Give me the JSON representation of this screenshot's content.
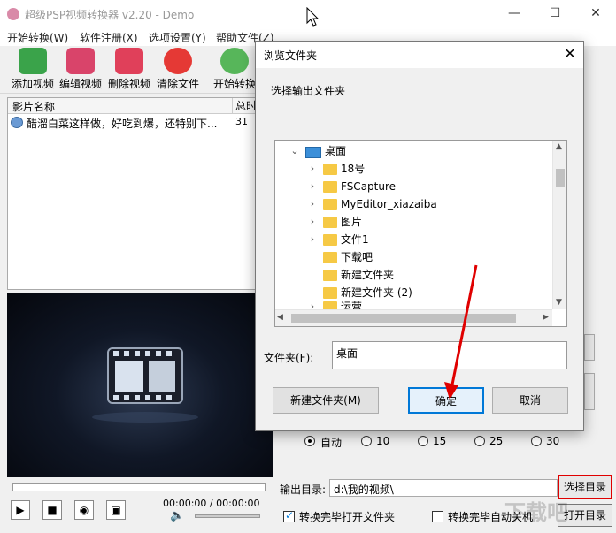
{
  "window": {
    "title": "超级PSP视频转换器 v2.20 - Demo"
  },
  "menu": [
    "开始转换(W)",
    "软件注册(X)",
    "选项设置(Y)",
    "帮助文件(Z)"
  ],
  "toolbar": [
    "添加视频",
    "编辑视频",
    "删除视频",
    "清除文件",
    "开始转换"
  ],
  "list": {
    "columns": [
      "影片名称",
      "总时"
    ],
    "rows": [
      {
        "name": "醋溜白菜这样做，好吃到爆，还特别下...",
        "duration": "31"
      }
    ]
  },
  "player": {
    "time": "00:00:00 / 00:00:00"
  },
  "framerate": {
    "options": [
      "自动",
      "10",
      "15",
      "25",
      "30"
    ],
    "selected": "自动"
  },
  "output": {
    "label": "输出目录:",
    "path": "d:\\我的视频\\",
    "choose_button": "选择目录",
    "open_button": "打开目录",
    "open_after": "转换完毕打开文件夹",
    "shutdown_after": "转换完毕自动关机"
  },
  "dialog": {
    "title": "浏览文件夹",
    "description": "选择输出文件夹",
    "tree": [
      {
        "label": "桌面",
        "expanded": true,
        "root": true
      },
      {
        "label": "18号",
        "expandable": true
      },
      {
        "label": "FSCapture",
        "expandable": true
      },
      {
        "label": "MyEditor_xiazaiba",
        "expandable": true
      },
      {
        "label": "图片",
        "expandable": true
      },
      {
        "label": "文件1",
        "expandable": true
      },
      {
        "label": "下载吧",
        "expandable": false
      },
      {
        "label": "新建文件夹",
        "expandable": false
      },
      {
        "label": "新建文件夹 (2)",
        "expandable": false
      },
      {
        "label": "运营",
        "expandable": true
      }
    ],
    "folder_label": "文件夹(F):",
    "folder_value": "桌面",
    "new_folder_button": "新建文件夹(M)",
    "ok_button": "确定",
    "cancel_button": "取消"
  },
  "watermark": "下载吧",
  "colors": {
    "highlight": "#e00000",
    "folder": "#f6c945",
    "desktop": "#3b8fd9",
    "focus": "#0078d7"
  }
}
